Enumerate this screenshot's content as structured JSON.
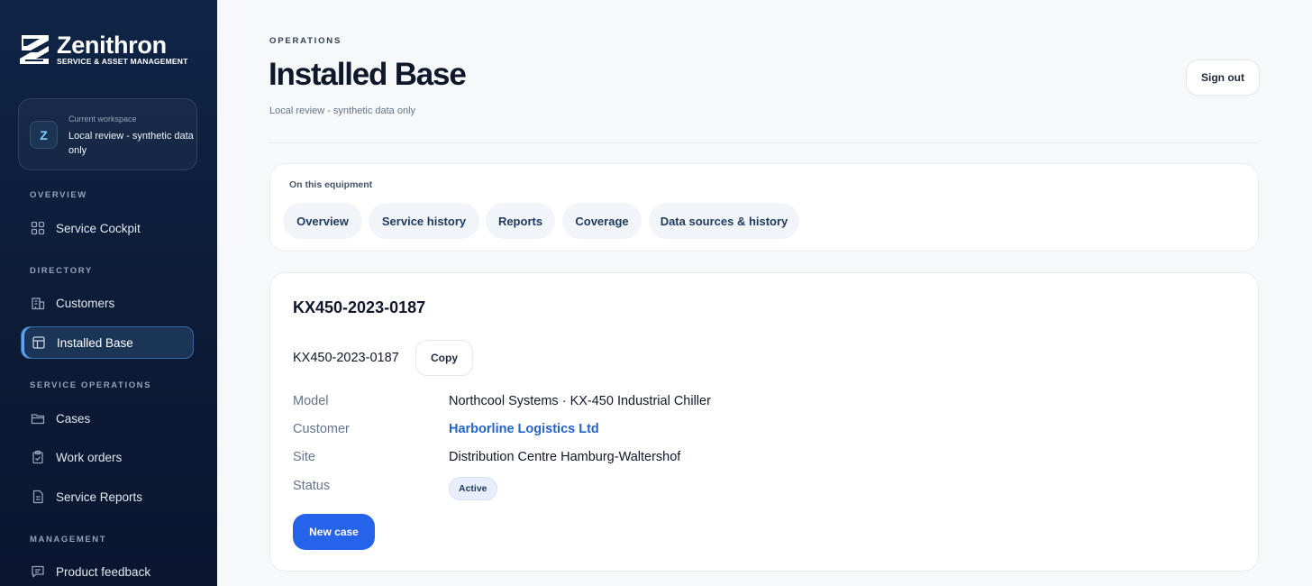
{
  "brand": {
    "name": "Zenithron",
    "tagline": "SERVICE & ASSET MANAGEMENT"
  },
  "workspace": {
    "caption": "Current workspace",
    "avatar_letter": "Z",
    "value": "Local review - synthetic data only"
  },
  "sidebar": {
    "sections": [
      {
        "label": "OVERVIEW"
      },
      {
        "label": "DIRECTORY"
      },
      {
        "label": "SERVICE OPERATIONS"
      },
      {
        "label": "MANAGEMENT"
      }
    ],
    "items": [
      {
        "label": "Service Cockpit",
        "icon": "grid-icon"
      },
      {
        "label": "Customers",
        "icon": "building-icon"
      },
      {
        "label": "Installed Base",
        "icon": "layout-icon",
        "active": true
      },
      {
        "label": "Cases",
        "icon": "folder-icon"
      },
      {
        "label": "Work orders",
        "icon": "clipboard-icon"
      },
      {
        "label": "Service Reports",
        "icon": "document-icon"
      },
      {
        "label": "Product feedback",
        "icon": "message-icon"
      }
    ]
  },
  "header": {
    "eyebrow": "OPERATIONS",
    "title": "Installed Base",
    "subtitle": "Local review - synthetic data only",
    "sign_out_label": "Sign out"
  },
  "tabs": {
    "caption": "On this equipment",
    "items": [
      {
        "label": "Overview"
      },
      {
        "label": "Service history"
      },
      {
        "label": "Reports"
      },
      {
        "label": "Coverage"
      },
      {
        "label": "Data sources & history"
      }
    ]
  },
  "equipment": {
    "title": "KX450-2023-0187",
    "serial": "KX450-2023-0187",
    "copy_label": "Copy",
    "fields": [
      {
        "label": "Model",
        "value": "Northcool Systems · KX-450 Industrial Chiller"
      },
      {
        "label": "Customer",
        "value": "Harborline Logistics Ltd"
      },
      {
        "label": "Site",
        "value": "Distribution Centre Hamburg-Waltershof"
      },
      {
        "label": "Status",
        "value": "Active"
      }
    ],
    "new_case_label": "New case"
  },
  "colors": {
    "accent": "#2563eb",
    "link": "#2563c9",
    "sidebar_bg": "#0c1b36"
  }
}
